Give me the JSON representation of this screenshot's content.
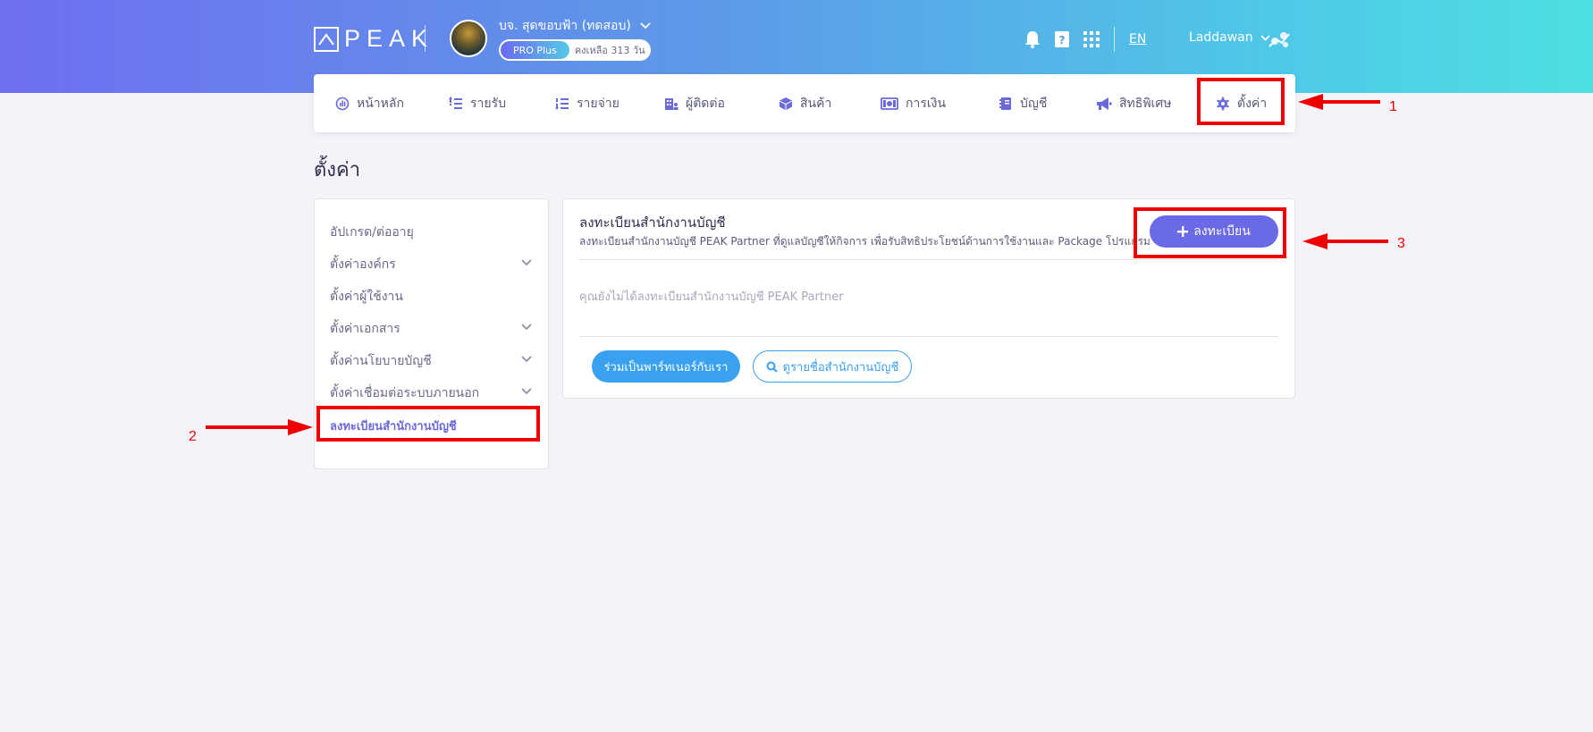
{
  "header": {
    "logo_text": "PEAK",
    "company_name": "บจ. สุดขอบฟ้า (ทดสอบ)",
    "plan_badge": "PRO Plus",
    "plan_remaining": "คงเหลือ 313 วัน",
    "language": "EN",
    "username": "Laddawan",
    "icons": [
      "bell-icon",
      "help-book-icon",
      "apps-grid-icon"
    ]
  },
  "nav": {
    "items": [
      {
        "label": "หน้าหลัก",
        "icon": "dashboard-icon"
      },
      {
        "label": "รายรับ",
        "icon": "income-icon"
      },
      {
        "label": "รายจ่าย",
        "icon": "expense-icon"
      },
      {
        "label": "ผู้ติดต่อ",
        "icon": "contacts-icon"
      },
      {
        "label": "สินค้า",
        "icon": "product-box-icon"
      },
      {
        "label": "การเงิน",
        "icon": "money-icon"
      },
      {
        "label": "บัญชี",
        "icon": "ledger-icon"
      },
      {
        "label": "สิทธิพิเศษ",
        "icon": "megaphone-icon"
      },
      {
        "label": "ตั้งค่า",
        "icon": "gear-icon"
      }
    ]
  },
  "page": {
    "title": "ตั้งค่า"
  },
  "sidebar": {
    "items": [
      {
        "label": "อัปเกรด/ต่ออายุ",
        "expandable": false
      },
      {
        "label": "ตั้งค่าองค์กร",
        "expandable": true
      },
      {
        "label": "ตั้งค่าผู้ใช้งาน",
        "expandable": false
      },
      {
        "label": "ตั้งค่าเอกสาร",
        "expandable": true
      },
      {
        "label": "ตั้งค่านโยบายบัญชี",
        "expandable": true
      },
      {
        "label": "ตั้งค่าเชื่อมต่อระบบภายนอก",
        "expandable": true
      },
      {
        "label": "ลงทะเบียนสำนักงานบัญชี",
        "expandable": false,
        "active": true
      }
    ]
  },
  "main": {
    "title": "ลงทะเบียนสำนักงานบัญชี",
    "description": "ลงทะเบียนสำนักงานบัญชี PEAK Partner ที่ดูแลบัญชีให้กิจการ เพื่อรับสิทธิประโยชน์ด้านการใช้งานและ Package โปรแกรม",
    "register_button": "ลงทะเบียน",
    "empty_message": "คุณยังไม่ได้ลงทะเบียนสำนักงานบัญชี PEAK Partner",
    "join_button": "ร่วมเป็นพาร์ทเนอร์กับเรา",
    "list_button": "ดูรายชื่อสำนักงานบัญชี"
  },
  "annotations": {
    "labels": [
      "1",
      "2",
      "3"
    ],
    "color": "#ee0000"
  },
  "colors": {
    "accent": "#6a6ae6",
    "blue_button": "#3aa0f0",
    "header_gradient_start": "#6f6ff0",
    "header_gradient_end": "#4de0e0"
  }
}
